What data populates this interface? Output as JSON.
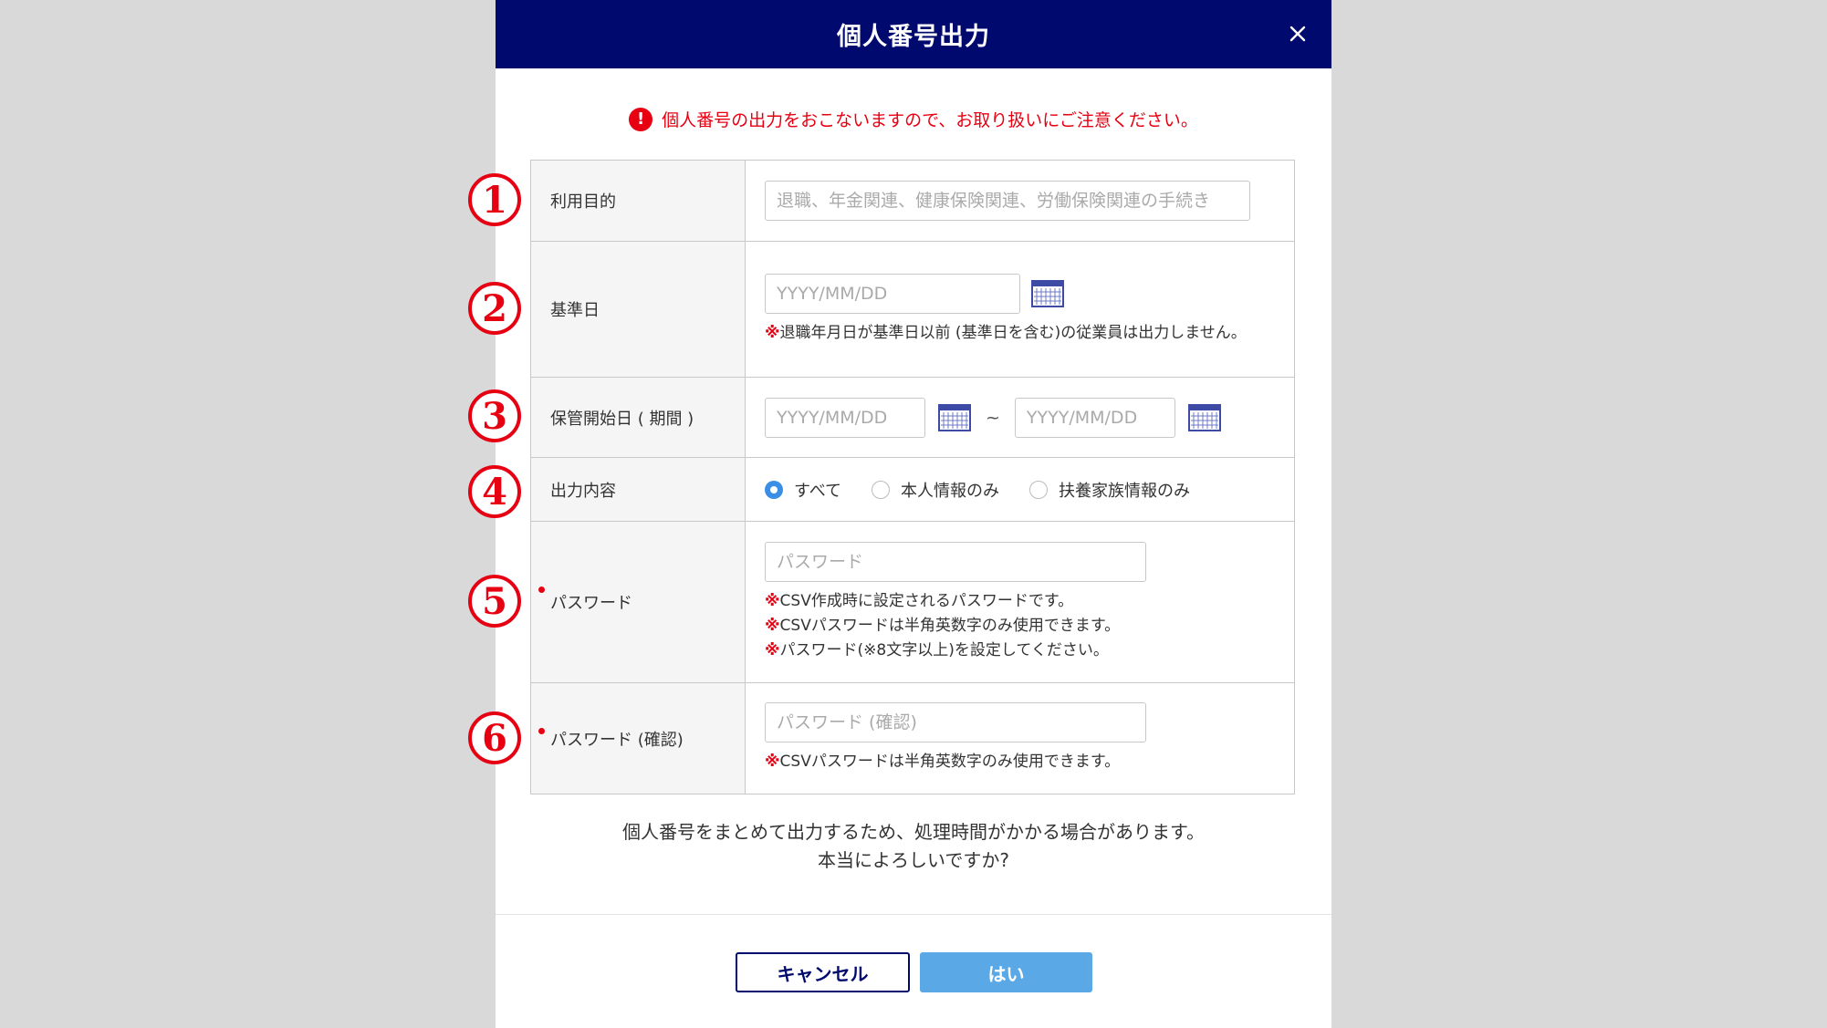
{
  "dialog": {
    "title": "個人番号出力",
    "warning": "個人番号の出力をおこないますので、お取り扱いにご注意ください。",
    "warning_icon": "!"
  },
  "annotations": [
    "1",
    "2",
    "3",
    "4",
    "5",
    "6"
  ],
  "form": {
    "purpose": {
      "label": "利用目的",
      "placeholder": "退職、年金関連、健康保険関連、労働保険関連の手続き"
    },
    "base_date": {
      "label": "基準日",
      "placeholder": "YYYY/MM/DD",
      "note_mark": "※",
      "note": "退職年月日が基準日以前 (基準日を含む)の従業員は出力しません。"
    },
    "storage_period": {
      "label": "保管開始日 ( 期間 )",
      "start_placeholder": "YYYY/MM/DD",
      "separator": "~",
      "end_placeholder": "YYYY/MM/DD"
    },
    "output_content": {
      "label": "出力内容",
      "options": [
        "すべて",
        "本人情報のみ",
        "扶養家族情報のみ"
      ],
      "selected": "すべて"
    },
    "password": {
      "label": "パスワード",
      "placeholder": "パスワード",
      "note_mark": "※",
      "notes": [
        "CSV作成時に設定されるパスワードです。",
        "CSVパスワードは半角英数字のみ使用できます。",
        "パスワード(※8文字以上)を設定してください。"
      ]
    },
    "password_confirm": {
      "label": "パスワード (確認)",
      "placeholder": "パスワード (確認)",
      "note_mark": "※",
      "note": "CSVパスワードは半角英数字のみ使用できます。"
    }
  },
  "confirm": {
    "line1": "個人番号をまとめて出力するため、処理時間がかかる場合があります。",
    "line2": "本当によろしいですか?"
  },
  "buttons": {
    "cancel": "キャンセル",
    "ok": "はい"
  },
  "colors": {
    "header": "#000a6e",
    "accent": "#5ba8e6",
    "warning": "#e60012"
  },
  "icons": {
    "close": "close-icon",
    "calendar": "calendar-icon",
    "alert": "alert-icon"
  }
}
